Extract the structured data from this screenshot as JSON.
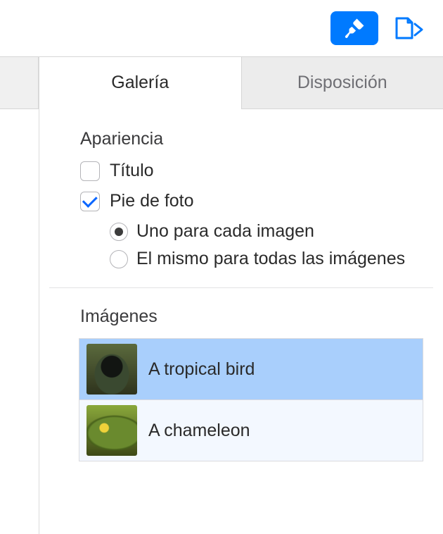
{
  "tabs": {
    "gallery": "Galería",
    "layout": "Disposición"
  },
  "appearance": {
    "heading": "Apariencia",
    "title_label": "Título",
    "title_checked": false,
    "caption_label": "Pie de foto",
    "caption_checked": true,
    "radio_each": "Uno para cada imagen",
    "radio_same": "El mismo para todas las imágenes",
    "radio_selected": "each"
  },
  "images": {
    "heading": "Imágenes",
    "items": [
      {
        "label": "A tropical bird",
        "selected": true,
        "thumb": "bird"
      },
      {
        "label": "A chameleon",
        "selected": false,
        "thumb": "chameleon"
      }
    ]
  }
}
